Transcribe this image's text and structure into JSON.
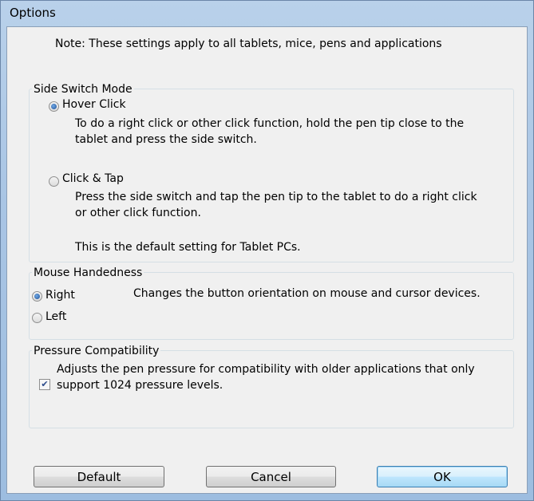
{
  "window": {
    "title": "Options"
  },
  "note": "Note: These settings apply to all tablets, mice, pens and applications",
  "side_switch": {
    "legend": "Side Switch Mode",
    "hover_click": {
      "label": "Hover Click",
      "checked": true,
      "desc_line1": "To do a right click or other click function, hold the pen tip close to the",
      "desc_line2": "tablet and press the side switch."
    },
    "click_tap": {
      "label": "Click & Tap",
      "checked": false,
      "desc_line1": "Press the side switch and tap the pen tip to the tablet to do a right click",
      "desc_line2": "or other click function.",
      "desc_default": "This is the default setting for Tablet PCs."
    }
  },
  "mouse": {
    "legend": "Mouse Handedness",
    "right_label": "Right",
    "left_label": "Left",
    "selected": "Right",
    "description": "Changes the button orientation on mouse and cursor devices."
  },
  "pressure": {
    "legend": "Pressure Compatibility",
    "checked": true,
    "line1": "Adjusts the pen pressure for compatibility with older applications that only",
    "line2": "support 1024 pressure levels."
  },
  "buttons": {
    "default_label": "Default",
    "cancel_label": "Cancel",
    "ok_label": "OK"
  },
  "colors": {
    "title_bar": "#a9c5e4",
    "client_bg": "#f0f0f0",
    "ok_button": "#bee6fd"
  }
}
